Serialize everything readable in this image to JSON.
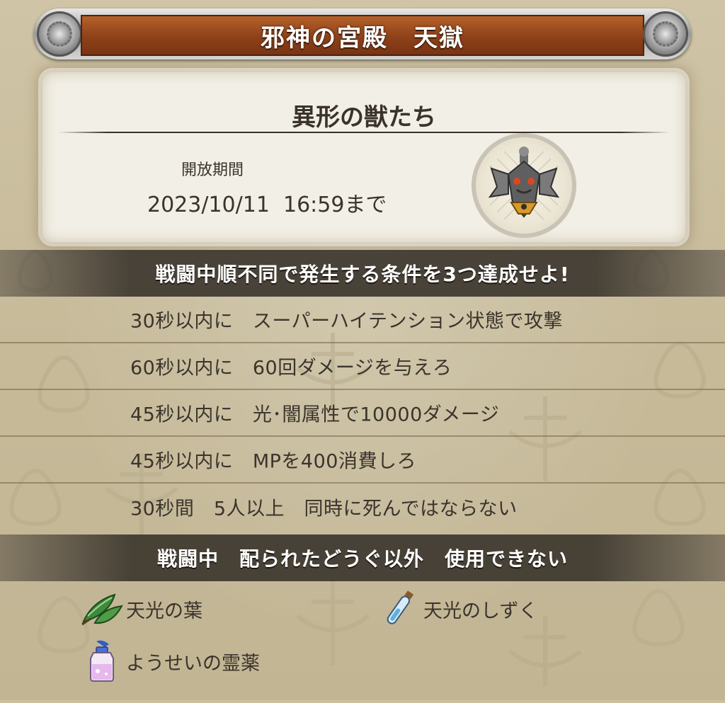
{
  "header": {
    "title": "邪神の宮殿　天獄"
  },
  "quest": {
    "name": "異形の獣たち",
    "period_label": "開放期間",
    "period_value": "2023/10/11  16:59まで",
    "emblem_icon": "winged-sword-emblem-icon"
  },
  "mission": {
    "header": "戦闘中順不同で発生する条件を3つ達成せよ!",
    "conditions": [
      "30秒以内に　スーパーハイテンション状態で攻撃",
      "60秒以内に　60回ダメージを与えろ",
      "45秒以内に　光･闇属性で10000ダメージ",
      "45秒以内に　MPを400消費しろ",
      "30秒間　5人以上　同時に死んではならない"
    ]
  },
  "restriction": {
    "header": "戦闘中　配られたどうぐ以外　使用できない",
    "items": [
      {
        "label": "天光の葉",
        "icon": "leaf-icon"
      },
      {
        "label": "天光のしずく",
        "icon": "vial-icon"
      },
      {
        "label": "ようせいの霊薬",
        "icon": "potion-bottle-icon"
      }
    ]
  },
  "colors": {
    "title_bar": "#8e4119",
    "band": "#3a342c",
    "background": "#c6ba99"
  }
}
